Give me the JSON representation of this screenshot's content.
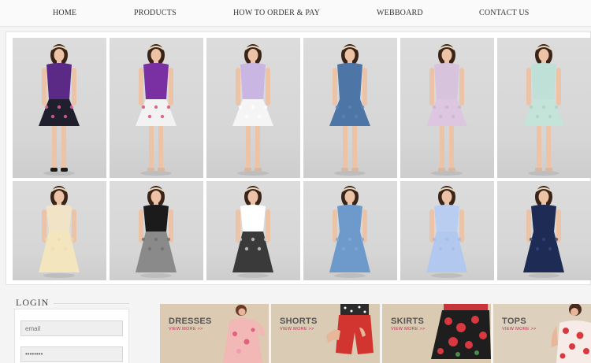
{
  "nav": {
    "items": [
      "HOME",
      "PRODUCTS",
      "HOW TO ORDER & PAY",
      "WEBBOARD",
      "CONTACT US"
    ]
  },
  "gallery": {
    "items": [
      {
        "top": "#5b2a86",
        "bottom": "#1f1f2e",
        "print": "#e86aa0",
        "shoes": "#1b1b1b"
      },
      {
        "top": "#7a2fa3",
        "bottom": "#f2f2f2",
        "print": "#d24b6a",
        "shoes": "#d9b7a0"
      },
      {
        "top": "#c9b6e3",
        "bottom": "#f5f5f5",
        "print": "#ffffff",
        "shoes": "#d9b7a0"
      },
      {
        "top": "#4d76a6",
        "bottom": "#4d76a6",
        "print": "#5d86b6",
        "shoes": "#d9b7a0"
      },
      {
        "top": "#d8c3dd",
        "bottom": "#ddc6e0",
        "print": "#cbb4d0",
        "shoes": "#d9b7a0"
      },
      {
        "top": "#bfe0d6",
        "bottom": "#c4e3d9",
        "print": "#a9d3c5",
        "shoes": "#d9b7a0"
      },
      {
        "top": "#f1e3c6",
        "bottom": "#f3e6bf",
        "print": "#efdcad",
        "shoes": "#d9b7a0"
      },
      {
        "top": "#1b1b1b",
        "bottom": "#8a8a8a",
        "print": "#6f6f6f",
        "shoes": "#d9b7a0"
      },
      {
        "top": "#ffffff",
        "bottom": "#3a3a3a",
        "print": "#cfcfcf",
        "shoes": "#d9b7a0"
      },
      {
        "top": "#6d9acb",
        "bottom": "#6d9acb",
        "print": "#7fa8d5",
        "shoes": "#d9b7a0"
      },
      {
        "top": "#b9cdf0",
        "bottom": "#b2c8ef",
        "print": "#a3bbe6",
        "shoes": "#d9b7a0"
      },
      {
        "top": "#1d2b55",
        "bottom": "#1d2b55",
        "print": "#34467a",
        "shoes": "#d9b7a0"
      }
    ]
  },
  "login": {
    "title": "LOGIN",
    "email_placeholder": "email",
    "password_value": "••••••••"
  },
  "categories": [
    {
      "name": "DRESSES",
      "more": "VIEW MORE >>"
    },
    {
      "name": "SHORTS",
      "more": "VIEW MORE >>"
    },
    {
      "name": "SKIRTS",
      "more": "VIEW MORE >>"
    },
    {
      "name": "TOPS",
      "more": "VIEW MORE >>"
    }
  ],
  "colors": {
    "accent": "#c0305a",
    "banner_bg": "#d8c8b0"
  }
}
